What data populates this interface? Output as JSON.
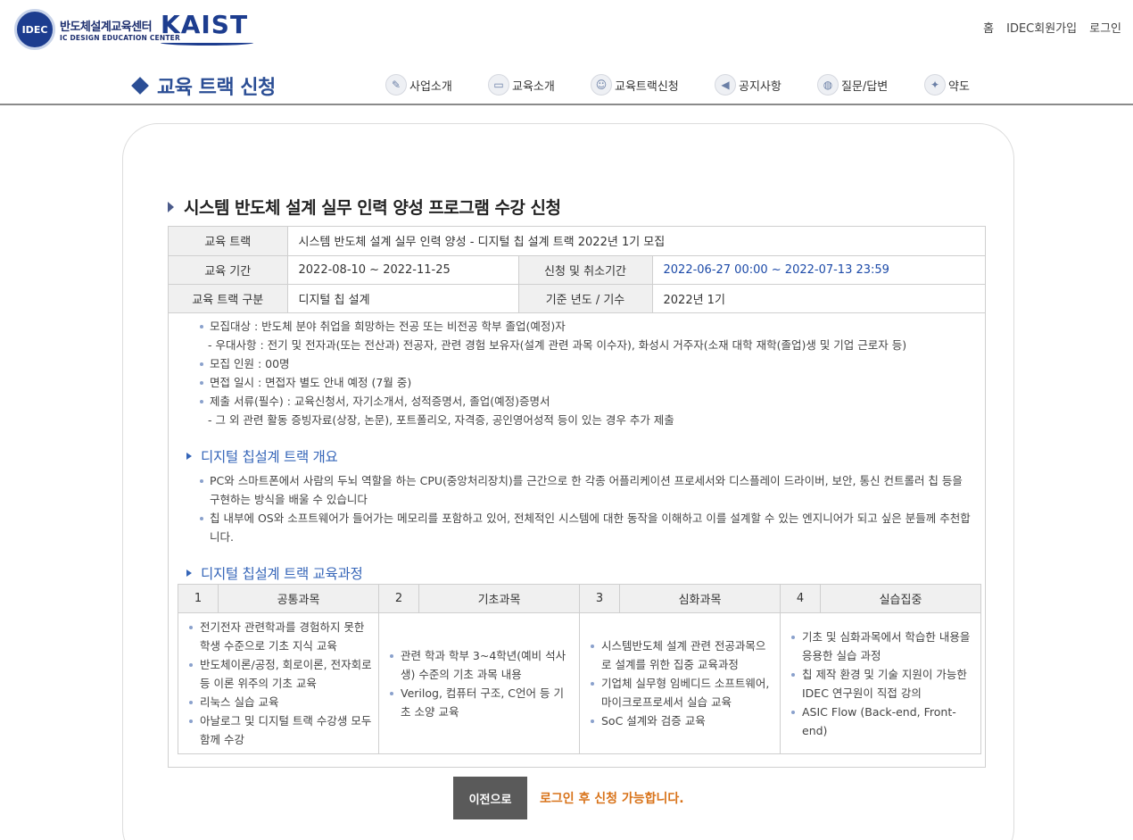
{
  "header": {
    "logo_idec_kr": "반도체설계교육센터",
    "logo_idec_en": "IC DESIGN EDUCATION CENTER",
    "logo_idec_mark": "IDEC",
    "logo_kaist": "KAIST",
    "util_links": [
      "홈",
      "IDEC회원가입",
      "로그인"
    ],
    "page_heading": "교육 트랙 신청",
    "nav": [
      {
        "label": "사업소개",
        "icon": "clipboard-icon"
      },
      {
        "label": "교육소개",
        "icon": "book-icon"
      },
      {
        "label": "교육트랙신청",
        "icon": "people-icon"
      },
      {
        "label": "공지사항",
        "icon": "megaphone-icon"
      },
      {
        "label": "질문/답변",
        "icon": "globe-icon"
      },
      {
        "label": "약도",
        "icon": "map-pin-icon"
      }
    ]
  },
  "program": {
    "title": "시스템 반도체 설계 실무 인력 양성 프로그램 수강 신청",
    "labels": {
      "track": "교육 트랙",
      "period": "교육 기간",
      "apply_period": "신청 및 취소기간",
      "track_type": "교육 트랙 구분",
      "base_year": "기준 년도 / 기수"
    },
    "track": "시스템 반도체 설계 실무 인력 양성 - 디지털 칩 설계 트랙 2022년 1기 모집",
    "period": "2022-08-10 ~ 2022-11-25",
    "apply_period": "2022-06-27 00:00 ~ 2022-07-13 23:59",
    "track_type": "디지털 칩 설계",
    "base_year": "2022년 1기"
  },
  "recruit": {
    "target": "모집대상 : 반도체 분야 취업을 희망하는 전공 또는 비전공 학부 졸업(예정)자",
    "priority": "- 우대사항 : 전기 및 전자과(또는 전산과) 전공자, 관련 경험 보유자(설계 관련 과목 이수자), 화성시 거주자(소재 대학 재학(졸업)생 및 기업 근로자 등)",
    "count": "모집 인원 : 00명",
    "interview": "면접 일시 : 면접자 별도 안내 예정 (7월 중)",
    "documents": "제출 서류(필수) : 교육신청서, 자기소개서, 성적증명서, 졸업(예정)증명서",
    "extra": "- 그 외 관련 활동 증빙자료(상장, 논문), 포트폴리오, 자격증, 공인영어성적 등이 있는 경우 추가 제출"
  },
  "overview": {
    "heading": "디지털 칩설계 트랙 개요",
    "items": [
      "PC와 스마트폰에서 사람의 두뇌 역할을 하는 CPU(중앙처리장치)를 근간으로 한 각종 어플리케이션 프로세서와 디스플레이 드라이버, 보안, 통신 컨트롤러 칩 등을 구현하는 방식을 배울 수 있습니다",
      "칩 내부에 OS와 소프트웨어가 들어가는 메모리를 포함하고 있어, 전체적인 시스템에 대한 동작을 이해하고 이를 설계할 수 있는 엔지니어가 되고 싶은 분들께 추천합니다."
    ]
  },
  "curriculum": {
    "heading": "디지털 칩설계 트랙 교육과정",
    "columns": [
      {
        "num": "1",
        "name": "공통과목",
        "items": [
          "전기전자 관련학과를 경험하지 못한 학생 수준으로 기초 지식 교육",
          "반도체이론/공정, 회로이론, 전자회로 등 이론 위주의 기초 교육",
          "리눅스 실습 교육",
          "아날로그 및 디지털 트랙 수강생 모두 함께 수강"
        ]
      },
      {
        "num": "2",
        "name": "기초과목",
        "items": [
          "관련 학과 학부 3~4학년(예비 석사생) 수준의 기초 과목 내용",
          "Verilog, 컴퓨터 구조, C언어 등 기초 소양 교육"
        ]
      },
      {
        "num": "3",
        "name": "심화과목",
        "items": [
          "시스템반도체 설계 관련 전공과목으로 설계를 위한 집중 교육과정",
          "기업체 실무형 임베디드 소프트웨어, 마이크로프로세서 실습 교육",
          "SoC 설계와 검증 교육"
        ]
      },
      {
        "num": "4",
        "name": "실습집중",
        "items": [
          "기초 및 심화과목에서 학습한 내용을 응용한 실습 과정",
          "칩 제작 환경 및 기술 지원이 가능한 IDEC 연구원이 직접 강의",
          "ASIC Flow (Back-end, Front-end)"
        ]
      }
    ]
  },
  "actions": {
    "prev_label": "이전으로",
    "login_note": "로그인 후 신청 가능합니다."
  }
}
